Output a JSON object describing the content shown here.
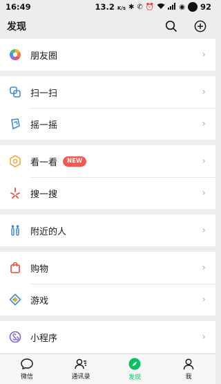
{
  "status_bar": {
    "time": "16:49",
    "speed": "13.2",
    "speed_unit": "K/s",
    "battery": "92"
  },
  "nav": {
    "title": "发现",
    "search_icon": "search-icon",
    "add_icon": "plus-circle-icon"
  },
  "groups": [
    [
      {
        "label": "朋友圈",
        "icon": "moments-icon"
      }
    ],
    [
      {
        "label": "扫一扫",
        "icon": "scan-icon"
      },
      {
        "label": "摇一摇",
        "icon": "shake-icon"
      }
    ],
    [
      {
        "label": "看一看",
        "icon": "top-stories-icon",
        "badge": "NEW"
      },
      {
        "label": "搜一搜",
        "icon": "search-star-icon"
      }
    ],
    [
      {
        "label": "附近的人",
        "icon": "people-nearby-icon"
      }
    ],
    [
      {
        "label": "购物",
        "icon": "shopping-bag-icon"
      },
      {
        "label": "游戏",
        "icon": "game-icon"
      }
    ],
    [
      {
        "label": "小程序",
        "icon": "mini-program-icon"
      }
    ]
  ],
  "tabs": [
    {
      "label": "微信",
      "icon": "chat-icon"
    },
    {
      "label": "通讯录",
      "icon": "contacts-icon"
    },
    {
      "label": "发现",
      "icon": "compass-icon",
      "active": true
    },
    {
      "label": "我",
      "icon": "me-icon"
    }
  ],
  "colors": {
    "accent": "#07c160",
    "badge": "#f25a4f",
    "background": "#ededed"
  }
}
